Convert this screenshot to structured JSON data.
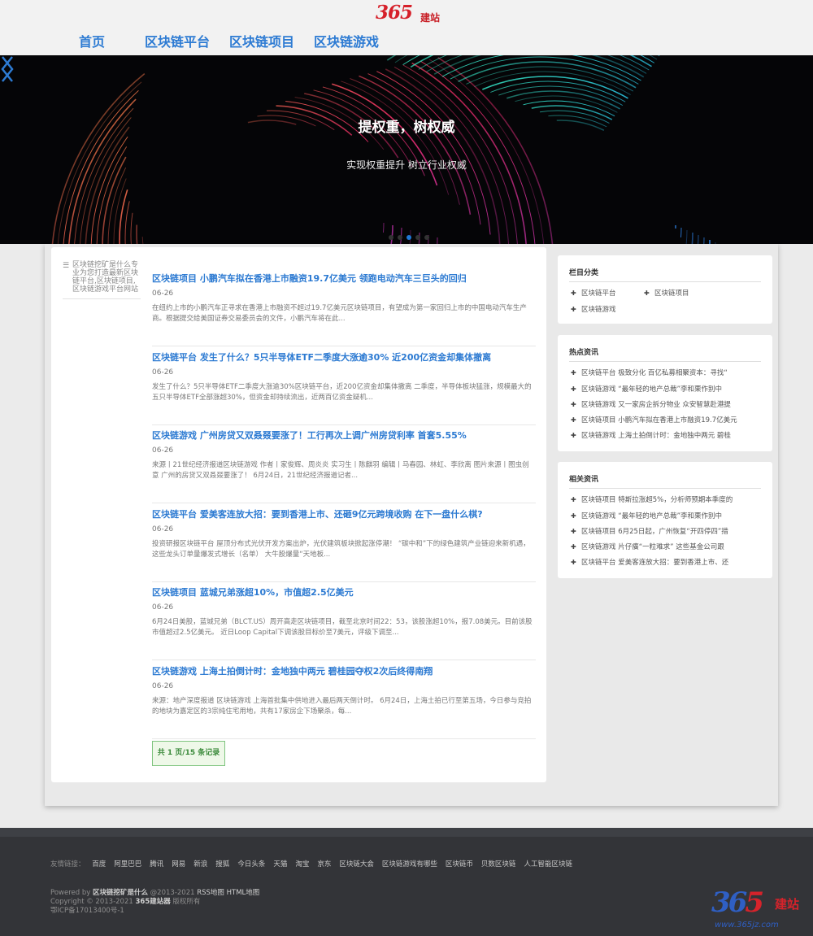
{
  "logo": {
    "num": "365",
    "text": "建站"
  },
  "nav": [
    {
      "label": "首页"
    },
    {
      "label": "区块链平台"
    },
    {
      "label": "区块链项目"
    },
    {
      "label": "区块链游戏"
    }
  ],
  "banner": {
    "title": "提权重，树权威",
    "subtitle": "实现权重提升 树立行业权威",
    "slide_count": 5,
    "active_slide": 2
  },
  "site_desc": "区块链挖矿是什么专业为您打造最新区块链平台,区块链项目,区块链游戏平台网站",
  "articles": [
    {
      "title": "区块链项目 小鹏汽车拟在香港上市融资19.7亿美元 领跑电动汽车三巨头的回归",
      "date": "06-26",
      "summary": "在纽约上市的小鹏汽车正寻求在香港上市融资不超过19.7亿美元区块链项目，有望成为第一家回归上市的中国电动汽车生产商。根据提交给美国证券交易委员会的文件，小鹏汽车将在此..."
    },
    {
      "title": "区块链平台 发生了什么？5只半导体ETF二季度大涨逾30% 近200亿资金却集体撤离",
      "date": "06-26",
      "summary": "发生了什么？5只半导体ETF二季度大涨逾30%区块链平台，近200亿资金却集体撤离 二季度，半导体板块猛涨，规模最大的五只半导体ETF全部涨超30%，但资金却持续流出，近两百亿资金疑机..."
    },
    {
      "title": "区块链游戏 广州房贷又双叒叕要涨了！工行再次上调广州房贷利率 首套5.55%",
      "date": "06-26",
      "summary": "来源丨21世纪经济报道区块链游戏 作者丨家俊辉、周炎炎 实习生丨陈麒羽 编辑丨马春园、林虹、李欣离 图片来源丨图虫创意 广州的房贷又双叒叕要涨了！ 6月24日，21世纪经济报道记者..."
    },
    {
      "title": "区块链平台 爱美客连放大招：要到香港上市、还砸9亿元跨境收购 在下一盘什么棋?",
      "date": "06-26",
      "summary": "投资研报区块链平台 屋顶分布式光伏开发方案出炉，光伏建筑板块掀起涨停潮！ “碳中和”下的绿色建筑产业链迎来新机遇，这些龙头订单量爆发式增长（名单） 大牛股爆量“天地板..."
    },
    {
      "title": "区块链项目 蓝城兄弟涨超10%，市值超2.5亿美元",
      "date": "06-26",
      "summary": "6月24日美股，蓝城兄弟（BLCT.US）周开高走区块链项目，截至北京时间22：53，该股涨超10%，报7.08美元。目前该股市值超过2.5亿美元。 近日Loop Capital下调该股目标价至7美元，评级下调至..."
    },
    {
      "title": "区块链游戏 上海土拍倒计时：金地独中两元 碧桂园夺权2次后终得南翔",
      "date": "06-26",
      "summary": "来源：地产深度报道 区块链游戏 上海首批集中供地进入最后两天倒计时。 6月24日，上海土拍已行至第五场，今日参与竞拍的地块为嘉定区的3宗纯住宅用地，共有17家房企下场聚杀，每..."
    }
  ],
  "pager": "共 1 页/15 条记录",
  "sidebar": {
    "categories": {
      "title": "栏目分类",
      "items": [
        "区块链平台",
        "区块链项目",
        "区块链游戏"
      ]
    },
    "hot": {
      "title": "热点资讯",
      "items": [
        "区块链平台 极致分化 百亿私募相聚资本：寻找“",
        "区块链游戏 “最年轻的地产总裁”李和栗作别中",
        "区块链游戏 又一家房企拆分物业 众安智慧赴港提",
        "区块链项目 小鹏汽车拟在香港上市融资19.7亿美元",
        "区块链游戏 上海土拍倒计时：金地独中两元 碧桂"
      ]
    },
    "related": {
      "title": "相关资讯",
      "items": [
        "区块链项目 特斯拉涨超5%，分析师预期本季度的",
        "区块链游戏 “最年轻的地产总裁”李和栗作别中",
        "区块链项目 6月25日起，广州恢复“开四停四”措",
        "区块链游戏 片仔癀“一粒难求” 这些基金公司跟",
        "区块链平台 爱美客连放大招：要到香港上市、还"
      ]
    }
  },
  "footer": {
    "links_label": "友情链接：",
    "links": [
      "百度",
      "阿里巴巴",
      "腾讯",
      "网易",
      "新浪",
      "搜狐",
      "今日头条",
      "天猫",
      "淘宝",
      "京东",
      "区块链大会",
      "区块链游戏有哪些",
      "区块链币",
      "贝数区块链",
      "人工智能区块链"
    ],
    "powered_prefix": "Powered by ",
    "powered_name": "区块链挖矿是什么",
    "powered_suffix": " @2013-2021 ",
    "rss": "RSS地图",
    "html_map": "HTML地图",
    "copyright_prefix": "Copyright © 2013-2021 ",
    "copyright_name": "365建站器",
    "copyright_suffix": " 版权所有",
    "icp": "鄂ICP备17013400号-1"
  },
  "watermark": {
    "num1": "36",
    "num2": "5",
    "text": "建站",
    "url": "www.365jz.com"
  },
  "colors": {
    "nav": "#2d7bd3",
    "link": "#2c7ad2",
    "logo_red": "#d6202a",
    "footer": "#333438"
  }
}
